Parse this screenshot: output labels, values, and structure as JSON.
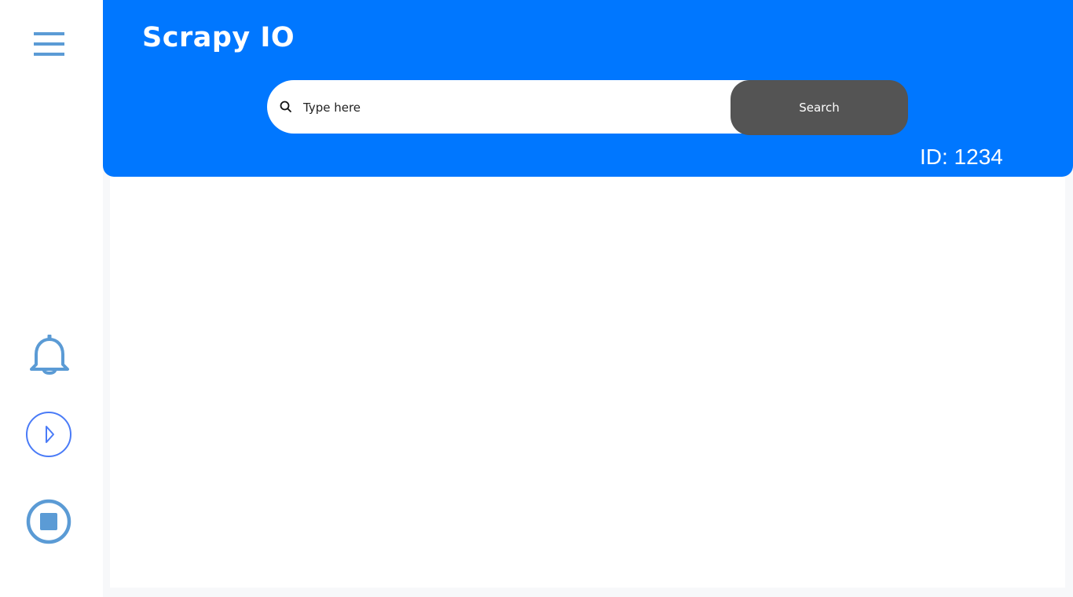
{
  "app": {
    "title": "Scrapy IO",
    "id_label": "ID: 1234"
  },
  "search": {
    "placeholder": "Type here",
    "value": "",
    "button_label": "Search"
  },
  "sidebar": {
    "icons": [
      "menu-icon",
      "bell-icon",
      "play-icon",
      "stop-icon"
    ]
  },
  "colors": {
    "header": "#0077ff",
    "search_button": "#545454",
    "icon": "#5b9bd5",
    "play_icon": "#4a7bf7"
  }
}
